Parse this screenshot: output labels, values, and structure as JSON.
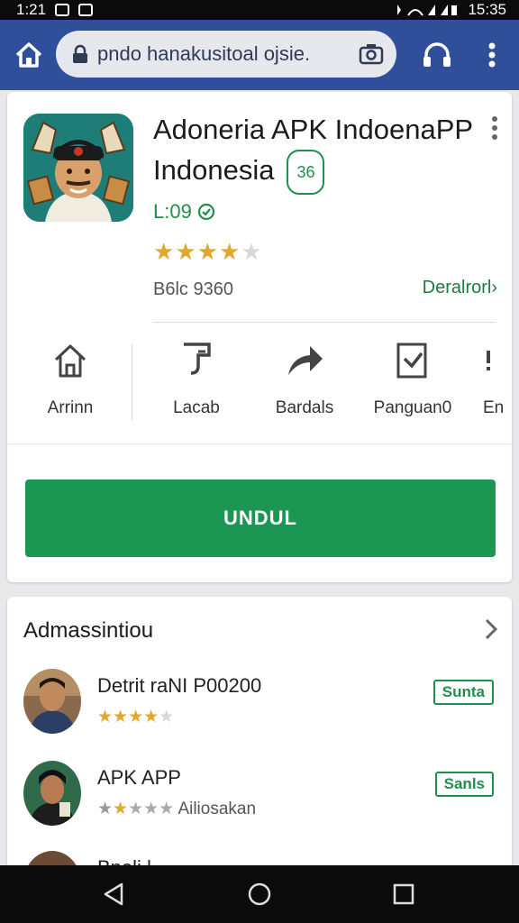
{
  "status": {
    "time": "1:21",
    "clock": "15:35"
  },
  "browser": {
    "url": "pndo hanakusitoal ojsie."
  },
  "app": {
    "title_line1": "Adoneria APK IndoenaPP",
    "title_line2": "Indonesia",
    "badge": "36",
    "version": "L:09",
    "rating_stars": 4,
    "size": "B6lc 9360",
    "detail_link": "Deralrorl›",
    "actions": [
      {
        "label": "Arrinn",
        "icon": "home-icon"
      },
      {
        "label": "Lacab",
        "icon": "signpost-icon"
      },
      {
        "label": "Bardals",
        "icon": "share-arrow-icon"
      },
      {
        "label": "Panguan0",
        "icon": "download-box-icon"
      },
      {
        "label": "En",
        "icon": "more-icon"
      }
    ],
    "download_label": "UNDUL"
  },
  "related": {
    "title": "Admassintiou",
    "items": [
      {
        "name": "Detrit raNI P00200",
        "stars": 3.5,
        "extra": "",
        "button": "Sunta"
      },
      {
        "name": "APK APP",
        "stars": 1.5,
        "extra": "Ailiosakan",
        "button": "Sanls"
      },
      {
        "name": "Bneli l. ..",
        "stars": 0,
        "extra": "",
        "button": ""
      }
    ]
  },
  "colors": {
    "toolbar": "#2f4f9b",
    "accent": "#1c9653",
    "star": "#e0a82e"
  }
}
